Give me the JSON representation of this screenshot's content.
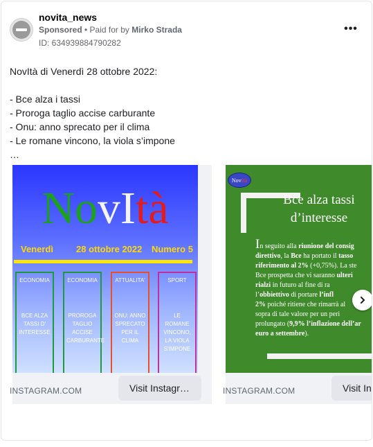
{
  "header": {
    "page_name": "novita_news",
    "sponsored_label": "Sponsored",
    "separator": " • ",
    "paid_for_by_prefix": "Paid for by",
    "payer": "Mirko Strada",
    "ad_id": "ID: 634939884790282",
    "more_icon": "more-horizontal-icon"
  },
  "body_text": {
    "lines": [
      "NovItà di Venerdì 28 ottobre 2022:",
      "",
      "- Bce alza i tassi",
      "- Proroga taglio accise carburante",
      "- Onu: anno sprecato per il clima",
      "- Le romane vincono, la viola s’impone",
      "…"
    ]
  },
  "carousel": {
    "next_icon": "chevron-right-icon",
    "slides": [
      {
        "domain": "INSTAGRAM.COM",
        "cta": "Visit Instagr…",
        "image": {
          "logo": {
            "part1": "No",
            "part2": "vI",
            "part3": "tà"
          },
          "day": "Venerdì",
          "date": "28 ottobre 2022",
          "issue": "Numero 5",
          "columns": [
            {
              "header": "ECONOMIA",
              "text": "BCE ALZA TASSI D' INTERESSE",
              "color": "#1e9a3a"
            },
            {
              "header": "ECONOMIA",
              "text": "PROROGA TAGLIO ACCISE CARBURANTE",
              "color": "#1e9a3a"
            },
            {
              "header": "ATTUALITA'",
              "text": "ONU: ANNO SPRECATO PER IL CLIMA",
              "color": "#e8502a"
            },
            {
              "header": "SPORT",
              "text": "LE ROMANE VINCONO, LA VIOLA S'IMPONE",
              "color": "#c0309a"
            }
          ],
          "colors": {
            "yellow": "#ffd800",
            "green": "#1da11d",
            "red": "#e41b1b"
          }
        }
      },
      {
        "domain": "INSTAGRAM.COM",
        "cta": "Visit Ins",
        "image": {
          "logo": {
            "part1": "Nov",
            "part2": "Ità"
          },
          "title_line1": "Bce alza tassi",
          "title_line2": "d’interesse",
          "dropcap": "I",
          "article": [
            {
              "plain": "n seguito alla ",
              "bold": "riunione del consig"
            },
            {
              "bold": "direttivo",
              "plain": ", la ",
              "bold2": "Bce",
              "plain2": " ha portato il ",
              "bold3": "tasso"
            },
            {
              "bold": "riferimento al 2%",
              "plain": " (+0,75%). La ste"
            },
            {
              "plain": "Bce prospetta che vi saranno ",
              "bold": "ulteri"
            },
            {
              "bold": "rialzi",
              "plain": " in futuro al fine di ra"
            },
            {
              "plain": "l’",
              "bold": "obbiettivo",
              "plain2": " di portare ",
              "bold2": "l’infl"
            },
            {
              "bold": "2%",
              "plain": " poiché ritiene che rimarrà al"
            },
            {
              "plain": "sopra di tale valore per un peri"
            },
            {
              "plain": "prolungato (",
              "bold": "9,9% l’inflazione dell’ar"
            },
            {
              "bold": "euro a settembre",
              "plain": ")."
            }
          ],
          "background": "#3f8a2b"
        }
      }
    ]
  }
}
